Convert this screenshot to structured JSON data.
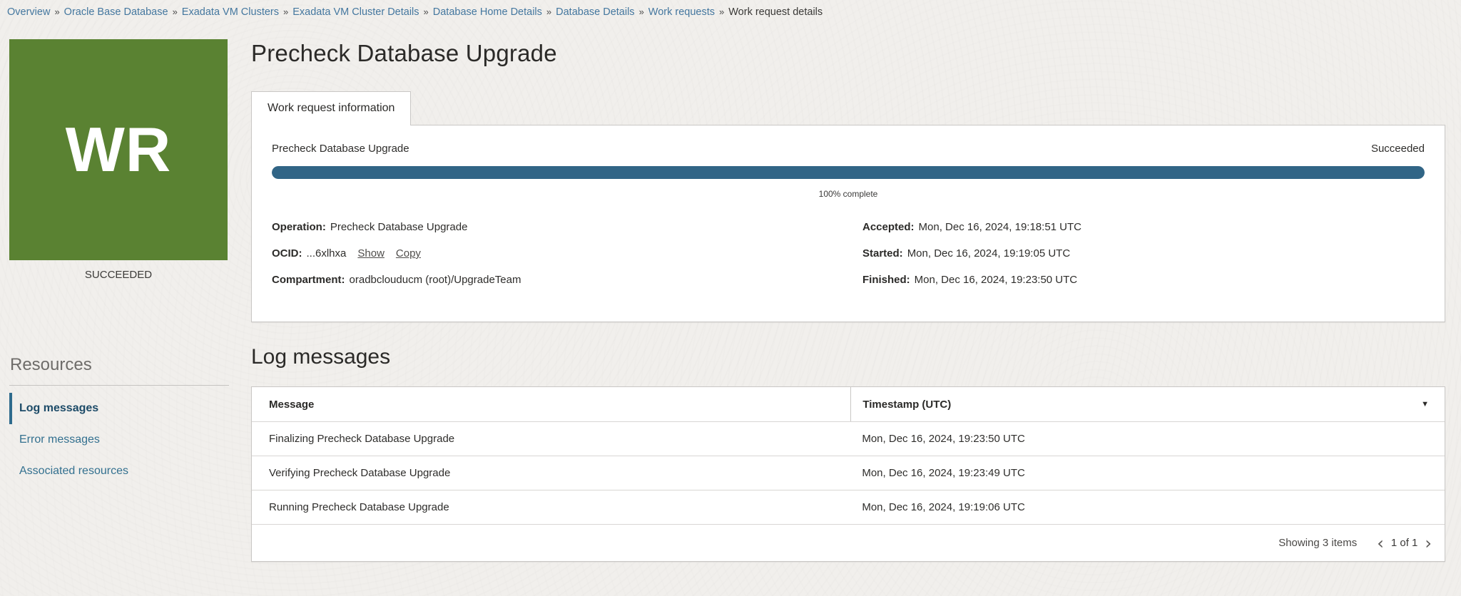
{
  "colors": {
    "avatar_green": "#5a8232",
    "progress_blue": "#316586",
    "link_blue": "#44779f",
    "sidebar_link": "#33708f",
    "sidebar_active": "#1d4b68",
    "page_bg": "#f1efec"
  },
  "breadcrumb": {
    "separator": "»",
    "items": [
      "Overview",
      "Oracle Base Database",
      "Exadata VM Clusters",
      "Exadata VM Cluster Details",
      "Database Home Details",
      "Database Details",
      "Work requests"
    ],
    "current": "Work request details"
  },
  "header": {
    "avatar_text": "WR",
    "status_caption": "SUCCEEDED",
    "title": "Precheck Database Upgrade"
  },
  "tabs": {
    "work_request_info": "Work request information"
  },
  "work_request": {
    "progress": {
      "label": "Precheck Database Upgrade",
      "status": "Succeeded",
      "percent": 100,
      "percent_label": "100% complete"
    },
    "operation": {
      "label": "Operation:",
      "value": "Precheck Database Upgrade"
    },
    "ocid": {
      "label": "OCID:",
      "value": "...6xlhxa",
      "show_link": "Show",
      "copy_link": "Copy"
    },
    "compartment": {
      "label": "Compartment:",
      "value": "oradbclouducm (root)/UpgradeTeam"
    },
    "accepted": {
      "label": "Accepted:",
      "value": "Mon, Dec 16, 2024, 19:18:51 UTC"
    },
    "started": {
      "label": "Started:",
      "value": "Mon, Dec 16, 2024, 19:19:05 UTC"
    },
    "finished": {
      "label": "Finished:",
      "value": "Mon, Dec 16, 2024, 19:23:50 UTC"
    }
  },
  "resources": {
    "heading": "Resources",
    "items": [
      {
        "label": "Log messages",
        "active": true
      },
      {
        "label": "Error messages",
        "active": false
      },
      {
        "label": "Associated resources",
        "active": false
      }
    ]
  },
  "log_section": {
    "heading": "Log messages",
    "table": {
      "columns": {
        "message": "Message",
        "timestamp": "Timestamp (UTC)"
      },
      "sort_icon": "▼",
      "rows": [
        [
          "Finalizing Precheck Database Upgrade",
          "Mon, Dec 16, 2024, 19:23:50 UTC"
        ],
        [
          "Verifying Precheck Database Upgrade",
          "Mon, Dec 16, 2024, 19:23:49 UTC"
        ],
        [
          "Running Precheck Database Upgrade",
          "Mon, Dec 16, 2024, 19:19:06 UTC"
        ]
      ],
      "footer": {
        "showing": "Showing 3 items",
        "page_label": "1 of 1",
        "prev_icon": "‹",
        "next_icon": "›"
      }
    }
  }
}
